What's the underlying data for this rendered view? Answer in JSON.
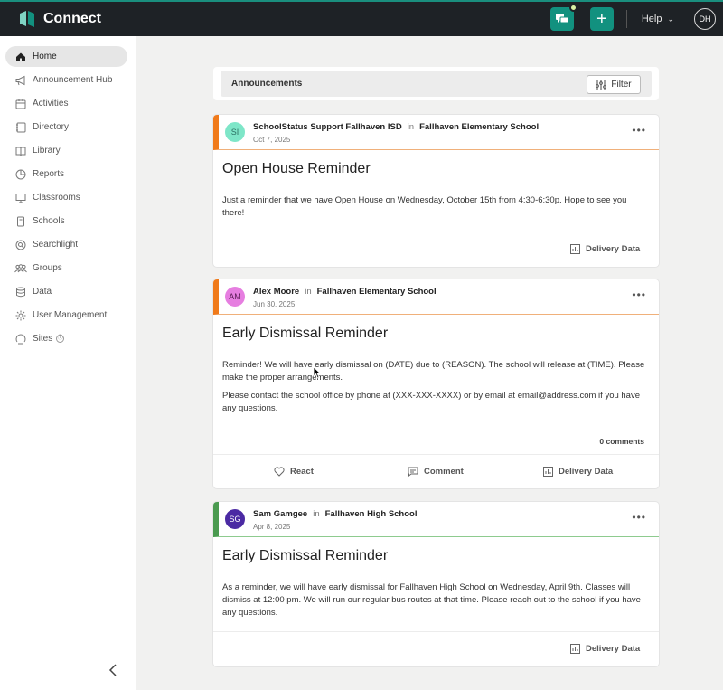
{
  "app": {
    "name": "Connect",
    "help_label": "Help",
    "user_initials": "DH"
  },
  "sidebar": {
    "items": [
      {
        "label": "Home",
        "icon": "home-icon",
        "active": true
      },
      {
        "label": "Announcement Hub",
        "icon": "megaphone-icon"
      },
      {
        "label": "Activities",
        "icon": "calendar-icon"
      },
      {
        "label": "Directory",
        "icon": "directory-icon"
      },
      {
        "label": "Library",
        "icon": "book-icon"
      },
      {
        "label": "Reports",
        "icon": "pie-chart-icon"
      },
      {
        "label": "Classrooms",
        "icon": "classroom-icon"
      },
      {
        "label": "Schools",
        "icon": "school-icon"
      },
      {
        "label": "Searchlight",
        "icon": "searchlight-icon"
      },
      {
        "label": "Groups",
        "icon": "groups-icon"
      },
      {
        "label": "Data",
        "icon": "database-icon"
      },
      {
        "label": "User Management",
        "icon": "gear-icon"
      },
      {
        "label": "Sites",
        "icon": "sites-icon"
      }
    ]
  },
  "announcements": {
    "title": "Announcements",
    "filter_label": "Filter"
  },
  "posts": [
    {
      "author": "SchoolStatus Support Fallhaven ISD",
      "initials": "SI",
      "in_label": "in",
      "school": "Fallhaven Elementary School",
      "date": "Oct 7, 2025",
      "title": "Open House Reminder",
      "body": [
        "Just a reminder that we have Open House on Wednesday, October 15th from 4:30-6:30p. Hope to see you there!"
      ],
      "delivery_label": "Delivery Data"
    },
    {
      "author": "Alex Moore",
      "initials": "AM",
      "in_label": "in",
      "school": "Fallhaven Elementary School",
      "date": "Jun 30, 2025",
      "title": "Early Dismissal Reminder",
      "body": [
        "Reminder! We will have early dismissal on (DATE) due to (REASON). The school will release at (TIME). Please make the proper arrangements.",
        "Please contact the school office by phone at (XXX-XXX-XXXX) or by email at email@address.com if you have any questions."
      ],
      "comments": "0 comments",
      "react_label": "React",
      "comment_label": "Comment",
      "delivery_label": "Delivery Data"
    },
    {
      "author": "Sam Gamgee",
      "initials": "SG",
      "in_label": "in",
      "school": "Fallhaven High School",
      "date": "Apr 8, 2025",
      "title": "Early Dismissal Reminder",
      "body": [
        "As a reminder, we will have early dismissal for Fallhaven High School on Wednesday, April 9th. Classes will dismiss at 12:00 pm. We will run our regular bus routes at that time. Please reach out to the school if you have any questions."
      ],
      "delivery_label": "Delivery Data"
    }
  ],
  "colors": {
    "brand": "#12917f",
    "topbar": "#1e2226",
    "accent_orange": "#f07a1a",
    "accent_green": "#4a9a4f"
  }
}
